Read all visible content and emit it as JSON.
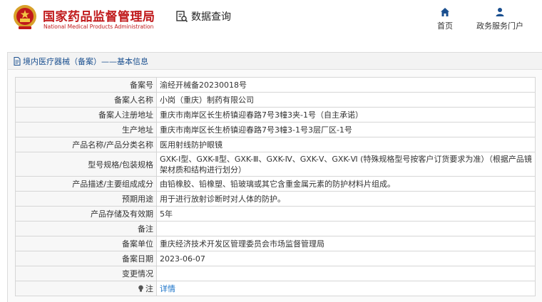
{
  "header": {
    "logo_cn": "国家药品监督管理局",
    "logo_en": "National Medical Products Administration",
    "query_label": "数据查询",
    "nav": {
      "home": "首页",
      "portal": "政务服务门户"
    }
  },
  "panel": {
    "title": "境内医疗器械（备案）——基本信息"
  },
  "rows": [
    {
      "label": "备案号",
      "value": "渝经开械备20230018号"
    },
    {
      "label": "备案人名称",
      "value": "小岗（重庆）制药有限公司"
    },
    {
      "label": "备案人注册地址",
      "value": "重庆市南岸区长生桥镇迎春路7号3幢3夹-1号（自主承诺）"
    },
    {
      "label": "生产地址",
      "value": "重庆市南岸区长生桥镇迎春路7号3幢3-1号3层厂区-1号"
    },
    {
      "label": "产品名称/产品分类名称",
      "value": "医用射线防护眼镜"
    },
    {
      "label": "型号规格/包装规格",
      "value": "GXK-Ⅰ型、GXK-Ⅱ型、GXK-Ⅲ、GXK-Ⅳ、GXK-Ⅴ、GXK-Ⅵ (特殊规格型号按客户订货要求为准）（根据产品镜架材质和结构进行划分）"
    },
    {
      "label": "产品描述/主要组成成分",
      "value": "由铅橡胶、铅橡塑、铅玻璃或其它含重金属元素的防护材料片组成。"
    },
    {
      "label": "预期用途",
      "value": "用于进行放射诊断时对人体的防护。"
    },
    {
      "label": "产品存储及有效期",
      "value": "5年"
    },
    {
      "label": "备注",
      "value": ""
    },
    {
      "label": "备案单位",
      "value": "重庆经济技术开发区管理委员会市场监督管理局"
    },
    {
      "label": "备案日期",
      "value": "2023-06-07"
    },
    {
      "label": "变更情况",
      "value": ""
    },
    {
      "label": "注",
      "value": "详情"
    }
  ],
  "colors": {
    "brand_red": "#c0191b",
    "link_blue": "#1a73c8",
    "nav_blue": "#1a4f8f"
  },
  "icons": {
    "emblem": "national-emblem",
    "query": "search-doc-icon",
    "home": "home-icon",
    "portal": "user-icon",
    "panel": "document-icon",
    "note": "lightbulb-icon"
  }
}
